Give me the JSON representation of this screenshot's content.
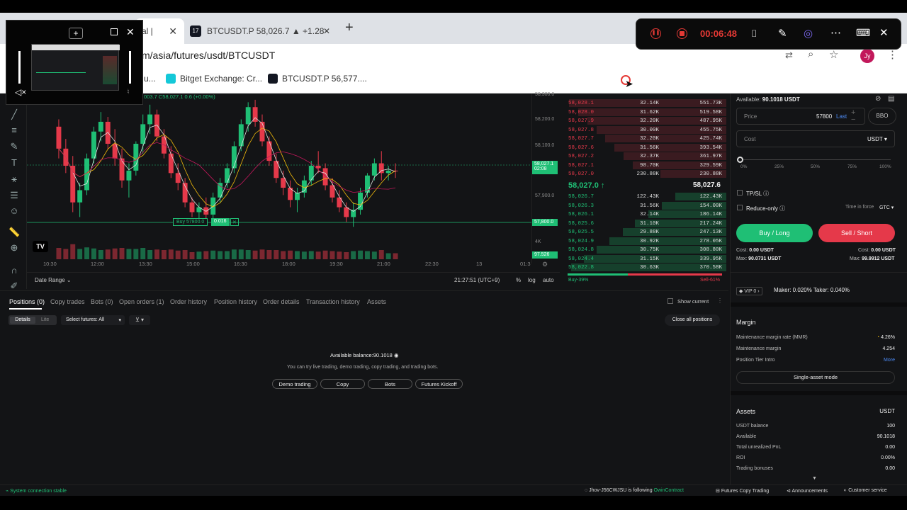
{
  "browser": {
    "tab1_label": "al | ",
    "tab2_label": "BTCUSDT.P 58,026.7 ▲ +1.28",
    "url": "m/asia/futures/usdt/BTCUSDT",
    "bookmarks": [
      "u...",
      "Bitget Exchange: Cr...",
      "BTCUSDT.P 56,577...."
    ],
    "avatar": "Jy"
  },
  "recorder": {
    "timer": "00:06:48"
  },
  "chart": {
    "ohlc": "003.7 C58,027.1 0.6 (+0.00%)",
    "price_ticks": [
      "58,300.0",
      "58,200.0",
      "58,100.0",
      "58,027.1",
      "02:08",
      "57,900.0",
      "57,800.0",
      "4K",
      "97.526"
    ],
    "time_ticks": [
      "10:30",
      "12:00",
      "13:30",
      "15:00",
      "16:30",
      "18:00",
      "19:30",
      "21:00",
      "22:30",
      "13",
      "01:3"
    ],
    "order_line_label": "Buy 57800.0",
    "order_line_qty": "0.016",
    "date_range": "Date Range",
    "clock": "21:27:51 (UTC+9)",
    "pct": "%",
    "log": "log",
    "auto": "auto",
    "tv": "TV"
  },
  "orderbook": {
    "asks": [
      [
        "58,028.1",
        "32.14K",
        "551.73K"
      ],
      [
        "58,028.0",
        "31.62K",
        "519.58K"
      ],
      [
        "58,027.9",
        "32.20K",
        "487.95K"
      ],
      [
        "58,027.8",
        "30.00K",
        "455.75K"
      ],
      [
        "58,027.7",
        "32.20K",
        "425.74K"
      ],
      [
        "58,027.6",
        "31.56K",
        "393.54K"
      ],
      [
        "58,027.2",
        "32.37K",
        "361.97K"
      ],
      [
        "58,027.1",
        "98.70K",
        "329.59K"
      ],
      [
        "58,027.0",
        "230.88K",
        "230.88K"
      ]
    ],
    "last_price": "58,027.0",
    "mark_price": "58,027.6",
    "bids": [
      [
        "58,026.7",
        "122.43K",
        "122.43K"
      ],
      [
        "58,026.3",
        "31.56K",
        "154.00K"
      ],
      [
        "58,026.1",
        "32.14K",
        "186.14K"
      ],
      [
        "58,025.6",
        "31.10K",
        "217.24K"
      ],
      [
        "58,025.5",
        "29.88K",
        "247.13K"
      ],
      [
        "58,024.9",
        "30.92K",
        "278.05K"
      ],
      [
        "58,024.8",
        "30.75K",
        "308.80K"
      ],
      [
        "58,024.4",
        "31.15K",
        "339.95K"
      ],
      [
        "58,022.8",
        "30.63K",
        "370.58K"
      ]
    ],
    "buy_pct": "Buy-39%",
    "sell_pct": "Sell-61%",
    "buy_ratio": 0.39
  },
  "trade": {
    "available_label": "Available:",
    "available_value": "90.1018 USDT",
    "price_label": "Price",
    "price_value": "57800",
    "last": "Last",
    "bbo": "BBO",
    "cost_label": "Cost",
    "cost_unit": "USDT",
    "slider_marks": [
      "0%",
      "25%",
      "50%",
      "75%",
      "100%"
    ],
    "tpsl": "TP/SL",
    "reduce_only": "Reduce-only",
    "tif_label": "Time in force",
    "tif_value": "GTC",
    "buy_btn": "Buy / Long",
    "sell_btn": "Sell / Short",
    "cost_left": "Cost: ",
    "cost_left_val": "0.00 USDT",
    "cost_right": "Cost: ",
    "cost_right_val": "0.00 USDT",
    "max_left": "Max: ",
    "max_left_val": "90.0731 USDT",
    "max_right": "Max: ",
    "max_right_val": "99.9912 USDT",
    "vip": "VIP 0",
    "fees": "Maker: 0.020%  Taker: 0.040%"
  },
  "margin": {
    "title": "Margin",
    "rows": [
      [
        "Maintenance margin rate (MMR)",
        "4.26%"
      ],
      [
        "Maintenance margin",
        "4.254"
      ],
      [
        "Position Tier Intro",
        "More"
      ]
    ],
    "mode_btn": "Single-asset mode"
  },
  "assets": {
    "title": "Assets",
    "unit": "USDT",
    "rows": [
      [
        "USDT balance",
        "100"
      ],
      [
        "Available",
        "90.1018"
      ],
      [
        "Total unrealized PnL",
        "0.00"
      ],
      [
        "ROI",
        "0.00%"
      ],
      [
        "Trading bonuses",
        "0.00"
      ]
    ]
  },
  "positions": {
    "tabs": [
      "Positions (0)",
      "Copy trades",
      "Bots (0)",
      "Open orders (1)",
      "Order history",
      "Position history",
      "Order details",
      "Transaction history",
      "Assets"
    ],
    "show_current": "Show current",
    "details": "Details",
    "lite": "Lite",
    "select_futures": "Select futures: All",
    "close_all": "Close all positions",
    "available_balance": "Available balance:90.1018",
    "hint": "You can try live trading, demo trading, copy trading, and trading bots.",
    "buttons": [
      "Demo trading",
      "Copy",
      "Bots",
      "Futures Kickoff"
    ]
  },
  "status": {
    "connection": "System connection stable",
    "following_user": "Jhov-J56CWJSU is following ",
    "following_target": "OwinContract",
    "links": [
      "Futures Copy Trading",
      "Announcements",
      "Customer service"
    ]
  },
  "colors": {
    "green": "#1fbf75",
    "red": "#e5394a",
    "bg": "#131416"
  },
  "candles": [
    [
      58210,
      58240,
      58080,
      58120
    ],
    [
      58120,
      58160,
      58020,
      58050
    ],
    [
      58050,
      58090,
      57860,
      57900
    ],
    [
      57900,
      57980,
      57840,
      57950
    ],
    [
      57950,
      58100,
      57930,
      58080
    ],
    [
      58080,
      58210,
      58060,
      58190
    ],
    [
      58190,
      58270,
      58150,
      58230
    ],
    [
      58230,
      58250,
      58120,
      58140
    ],
    [
      58140,
      58200,
      58050,
      58080
    ],
    [
      58080,
      58120,
      57960,
      57990
    ],
    [
      57990,
      58060,
      57920,
      58030
    ],
    [
      58030,
      58150,
      58010,
      58140
    ],
    [
      58140,
      58260,
      58100,
      58220
    ],
    [
      58220,
      58300,
      58180,
      58260
    ],
    [
      58260,
      58280,
      58150,
      58170
    ],
    [
      58170,
      58200,
      58080,
      58100
    ],
    [
      58100,
      58130,
      58000,
      58020
    ],
    [
      58020,
      58060,
      57950,
      57980
    ],
    [
      57980,
      58000,
      57880,
      57900
    ],
    [
      57900,
      57920,
      57840,
      57860
    ],
    [
      57860,
      57900,
      57810,
      57880
    ],
    [
      57880,
      57920,
      57820,
      57850
    ],
    [
      57850,
      57940,
      57830,
      57920
    ],
    [
      57920,
      58000,
      57900,
      57980
    ],
    [
      57980,
      58060,
      57960,
      58040
    ],
    [
      58040,
      58150,
      58020,
      58130
    ],
    [
      58130,
      58240,
      58110,
      58220
    ],
    [
      58220,
      58310,
      58190,
      58290
    ],
    [
      58290,
      58320,
      58210,
      58230
    ],
    [
      58230,
      58260,
      58130,
      58150
    ],
    [
      58150,
      58170,
      58050,
      58070
    ],
    [
      58070,
      58100,
      57980,
      58000
    ],
    [
      58000,
      58030,
      57930,
      57960
    ],
    [
      57960,
      57990,
      57880,
      57910
    ],
    [
      57910,
      57960,
      57860,
      57940
    ],
    [
      57940,
      58010,
      57920,
      57990
    ],
    [
      57990,
      58070,
      57970,
      58050
    ],
    [
      58050,
      58110,
      58020,
      58040
    ],
    [
      58040,
      58060,
      57950,
      57970
    ],
    [
      57970,
      58000,
      57900,
      57920
    ],
    [
      57920,
      57950,
      57860,
      57880
    ],
    [
      57880,
      57900,
      57820,
      57840
    ],
    [
      57840,
      57900,
      57800,
      57870
    ],
    [
      57870,
      57960,
      57850,
      57940
    ],
    [
      57940,
      58020,
      57920,
      58010
    ],
    [
      58010,
      58080,
      57990,
      58060
    ],
    [
      58060,
      58110,
      57990,
      58020
    ],
    [
      58020,
      58050,
      57990,
      58030
    ],
    [
      58030,
      58060,
      58000,
      58027
    ]
  ]
}
